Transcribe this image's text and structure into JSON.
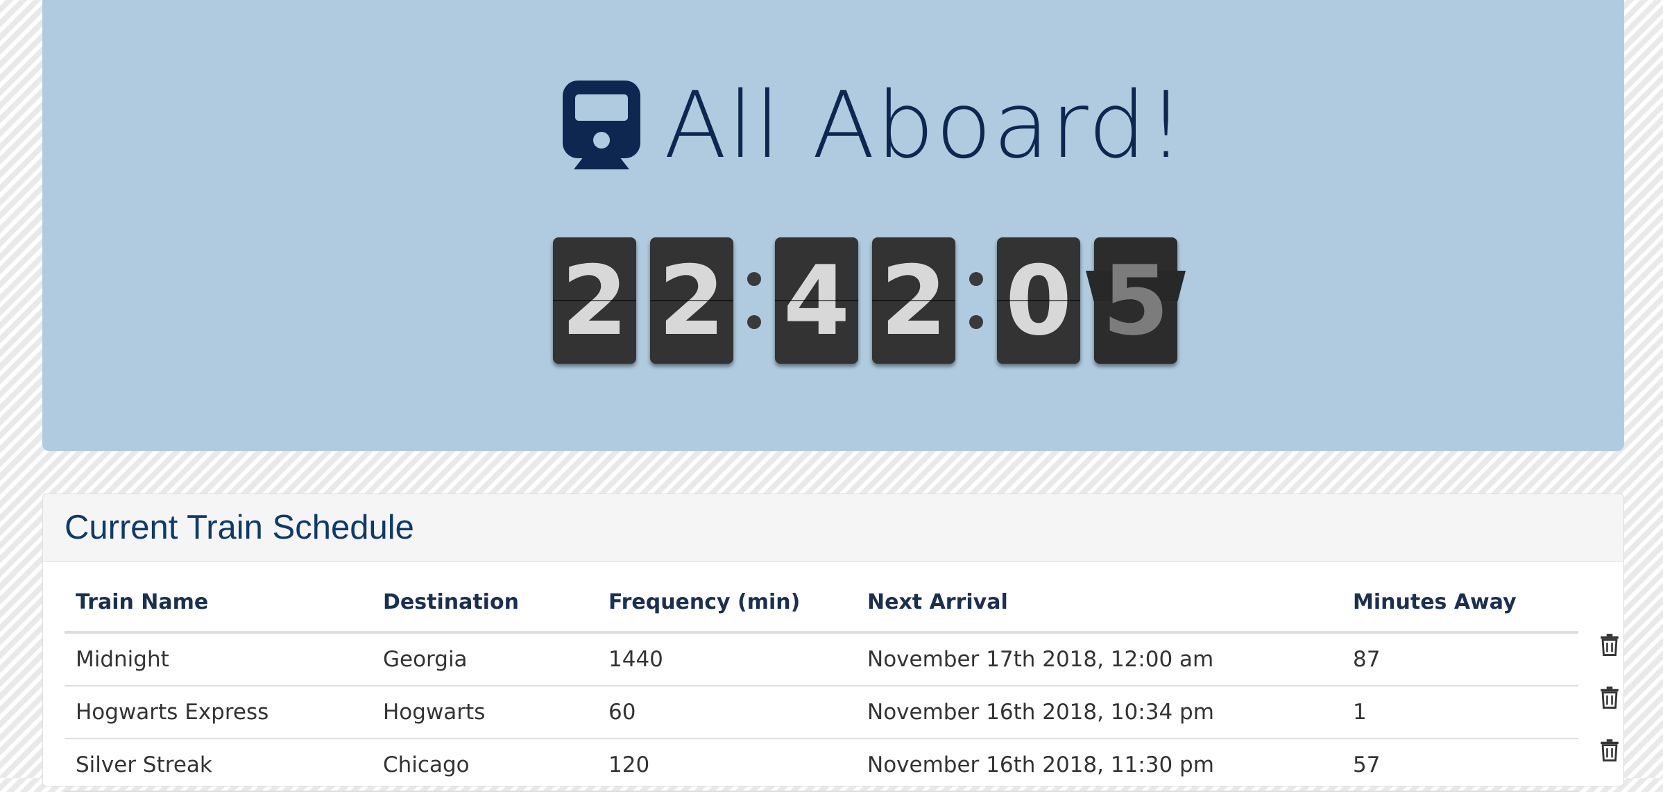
{
  "header": {
    "title": "All Aboard!",
    "clock": [
      "2",
      "2",
      "4",
      "2",
      "0",
      "5"
    ],
    "colors": {
      "hero_bg": "#b0cbdf",
      "title": "#0e2751",
      "flip_card": "#333333"
    }
  },
  "schedule": {
    "title": "Current Train Schedule",
    "columns": [
      "Train Name",
      "Destination",
      "Frequency (min)",
      "Next Arrival",
      "Minutes Away"
    ],
    "rows": [
      {
        "name": "Midnight",
        "destination": "Georgia",
        "frequency": "1440",
        "next_arrival": "November 17th 2018, 12:00 am",
        "minutes_away": "87",
        "delete_icon": "trash-icon"
      },
      {
        "name": "Hogwarts Express",
        "destination": "Hogwarts",
        "frequency": "60",
        "next_arrival": "November 16th 2018, 10:34 pm",
        "minutes_away": "1",
        "delete_icon": "trash-icon"
      },
      {
        "name": "Silver Streak",
        "destination": "Chicago",
        "frequency": "120",
        "next_arrival": "November 16th 2018, 11:30 pm",
        "minutes_away": "57",
        "delete_icon": "trash-icon"
      }
    ]
  }
}
